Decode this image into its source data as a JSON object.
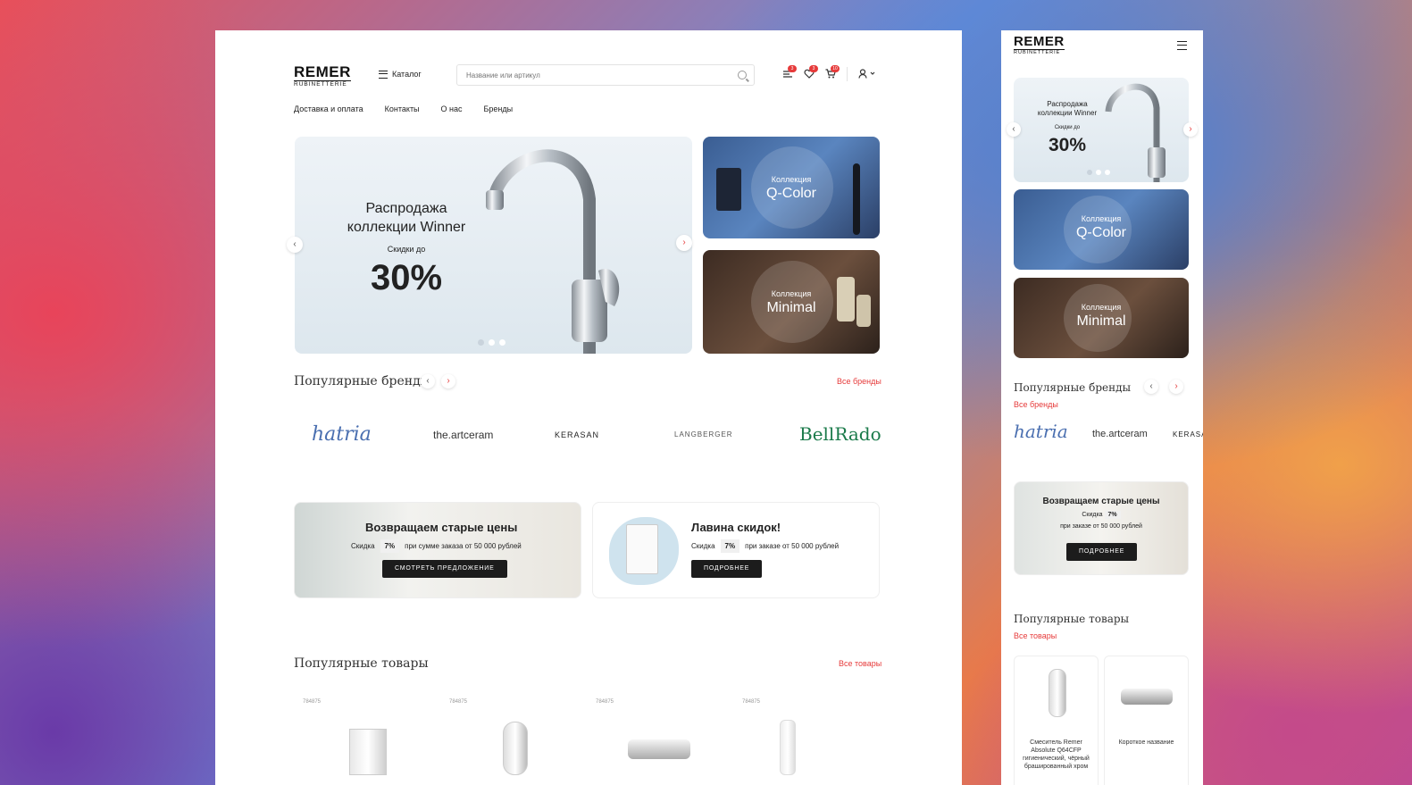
{
  "logo": {
    "name": "REMER",
    "sub": "RUBINETTERIE"
  },
  "header": {
    "catalog_label": "Каталог",
    "search_placeholder": "Название или артикул",
    "compare_count": "3",
    "favorites_count": "3",
    "cart_count": "10"
  },
  "nav": [
    "Доставка и оплата",
    "Контакты",
    "О нас",
    "Бренды"
  ],
  "hero": {
    "title_line1": "Распродажа",
    "title_line2": "коллекции Winner",
    "subtitle": "Скидки до",
    "discount": "30%"
  },
  "collections": [
    {
      "label": "Коллекция",
      "name": "Q-Color"
    },
    {
      "label": "Коллекция",
      "name": "Minimal"
    }
  ],
  "brands": {
    "title": "Популярные бренды",
    "all_link": "Все бренды",
    "items": [
      "hatria",
      "the.artceram",
      "KERASAN",
      "LANGBERGER",
      "BellRado"
    ]
  },
  "promos": [
    {
      "title": "Возвращаем старые цены",
      "discount_label": "Скидка",
      "discount": "7%",
      "condition": "при сумме заказа от 50 000 рублей",
      "button": "СМОТРЕТЬ ПРЕДЛОЖЕНИЕ"
    },
    {
      "title": "Лавина скидок!",
      "discount_label": "Скидка",
      "discount": "7%",
      "condition": "при заказе от 50 000 рублей",
      "button": "ПОДРОБНЕЕ"
    }
  ],
  "products": {
    "title": "Популярные товары",
    "all_link": "Все товары",
    "skus": [
      "784875",
      "784875",
      "784875",
      "784875"
    ]
  },
  "mobile": {
    "promo_title": "Возвращаем старые цены",
    "promo_condition": "при заказе от 50 000 рублей",
    "promo_button": "ПОДРОБНЕЕ",
    "product1_name": "Смеситель Remer Absolute Q64CFP гигиенический, чёрный брашированный хром",
    "product2_name": "Короткое название"
  }
}
